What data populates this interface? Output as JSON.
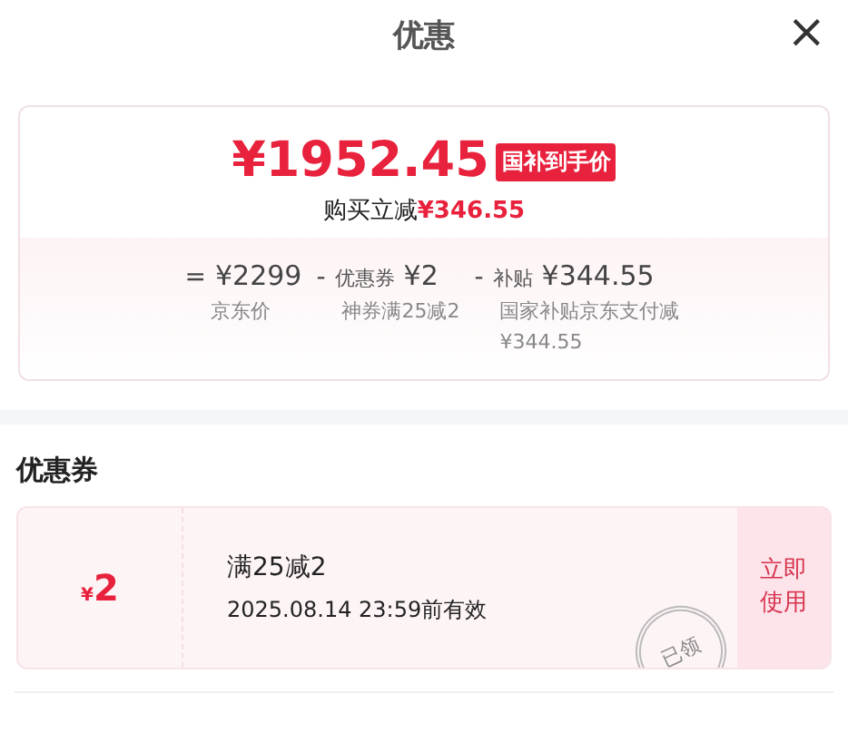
{
  "header": {
    "title": "优惠",
    "close": "×"
  },
  "summary": {
    "price": "¥1952.45",
    "badge": "国补到手价",
    "saving_label": "购买立减",
    "saving_value": "¥346.55",
    "breakdown": [
      {
        "op": "=",
        "amount": "¥2299",
        "note": "京东价"
      },
      {
        "op": "-",
        "label": "优惠券",
        "amount": "¥2",
        "note": "神券满25减2"
      },
      {
        "op": "-",
        "label": "补贴",
        "amount": "¥344.55",
        "note": "国家补贴京东支付减¥344.55"
      }
    ]
  },
  "coupons_section": {
    "title": "优惠券",
    "coupons": [
      {
        "currency": "¥",
        "amount": "2",
        "title": "满25减2",
        "validity": "2025.08.14 23:59前有效",
        "stamp": "已领",
        "claimed": true,
        "action": "立即使用"
      }
    ]
  }
}
